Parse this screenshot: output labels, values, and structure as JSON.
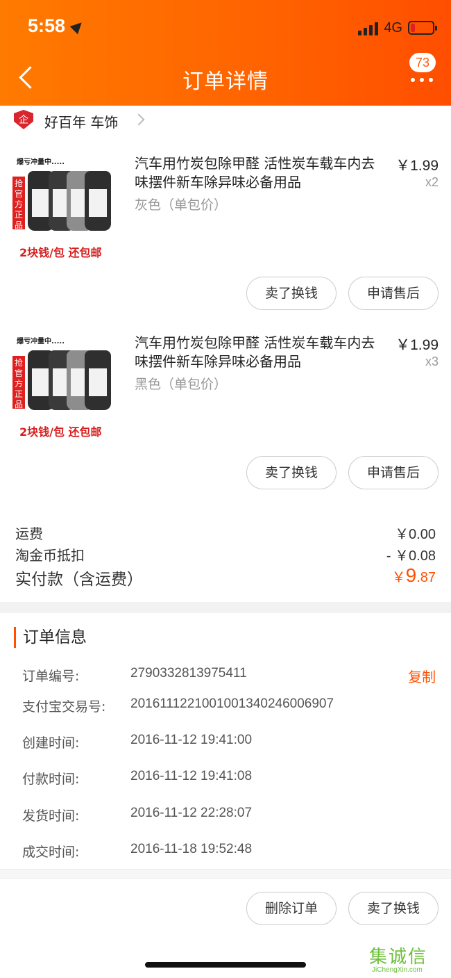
{
  "status_bar": {
    "time": "5:58",
    "network": "4G"
  },
  "header": {
    "title": "订单详情",
    "badge_count": "73"
  },
  "shop": {
    "logo_text": "企",
    "name": "好百年 车饰"
  },
  "products": [
    {
      "title": "汽车用竹炭包除甲醛 活性炭车载车内去味摆件新车除异味必备用品",
      "variant": "灰色（单包价）",
      "price": "￥1.99",
      "qty": "x2",
      "thumb_hot": "爆亏冲量中.....",
      "thumb_tag": "抢官方正品",
      "thumb_promo": "2块钱/包 还包邮",
      "btn_sell": "卖了换钱",
      "btn_after": "申请售后"
    },
    {
      "title": "汽车用竹炭包除甲醛 活性炭车载车内去味摆件新车除异味必备用品",
      "variant": "黑色（单包价）",
      "price": "￥1.99",
      "qty": "x3",
      "thumb_hot": "爆亏冲量中.....",
      "thumb_tag": "抢官方正品",
      "thumb_promo": "2块钱/包 还包邮",
      "btn_sell": "卖了换钱",
      "btn_after": "申请售后"
    }
  ],
  "summary": {
    "shipping_label": "运费",
    "shipping_value": "￥0.00",
    "coin_label": "淘金币抵扣",
    "coin_value": "- ￥0.08",
    "total_label": "实付款（含运费）",
    "total_currency": "￥",
    "total_int": "9",
    "total_dec": ".87"
  },
  "order_info": {
    "heading": "订单信息",
    "copy_label": "复制",
    "rows": [
      {
        "key": "订单编号:",
        "value": "2790332813975411"
      },
      {
        "key": "支付宝交易号:",
        "value": "2016111221001001340246006907"
      },
      {
        "key": "创建时间:",
        "value": "2016-11-12 19:41:00"
      },
      {
        "key": "付款时间:",
        "value": "2016-11-12 19:41:08"
      },
      {
        "key": "发货时间:",
        "value": "2016-11-12 22:28:07"
      },
      {
        "key": "成交时间:",
        "value": "2016-11-18 19:52:48"
      }
    ]
  },
  "bottom_bar": {
    "delete_label": "删除订单",
    "sell_label": "卖了换钱"
  },
  "watermark": {
    "cn": "集诚信",
    "en": "JiChengXin.com"
  }
}
